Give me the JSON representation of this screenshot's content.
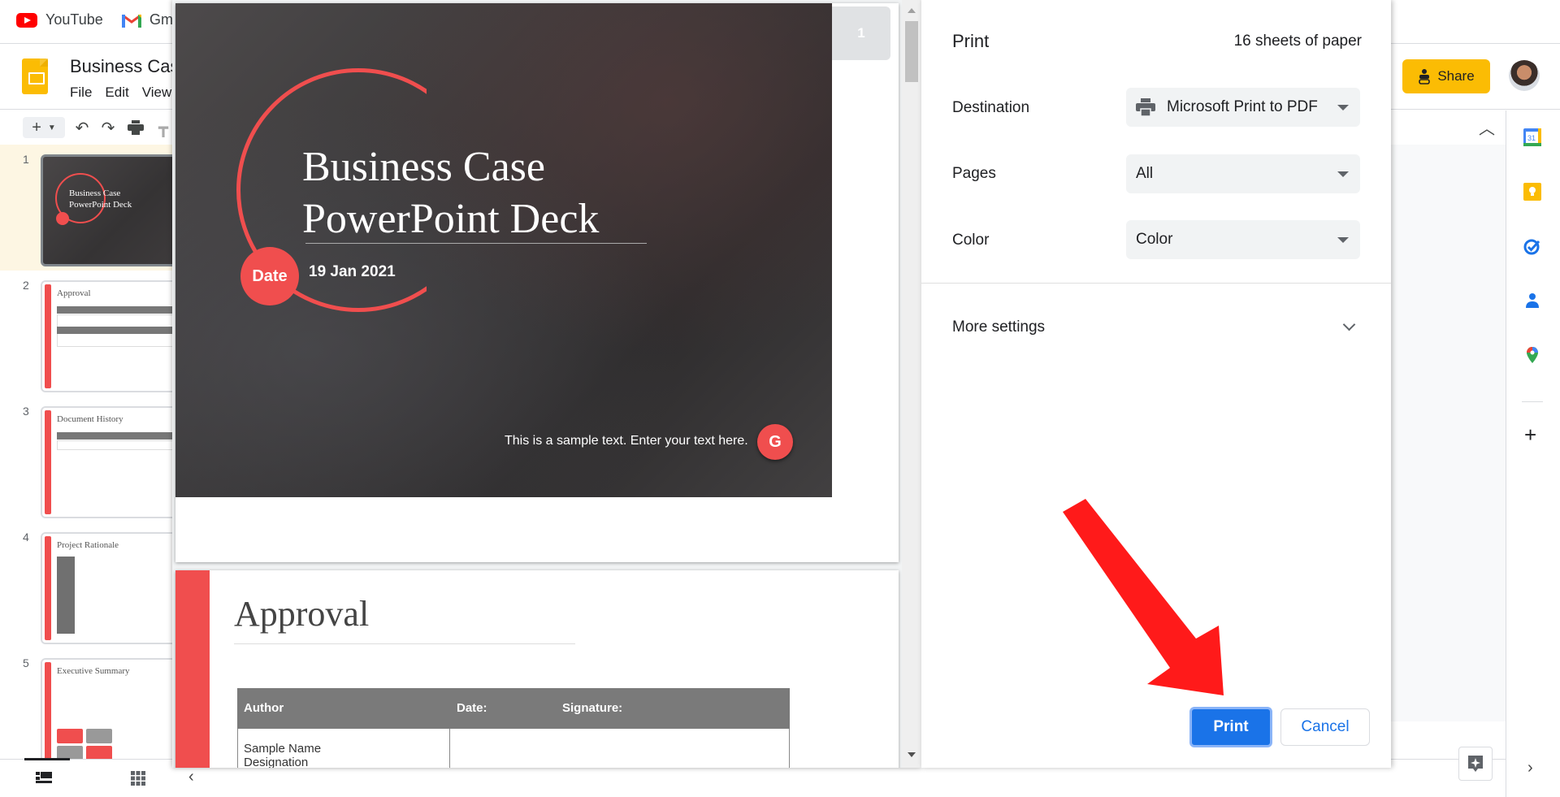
{
  "bookmarks": [
    {
      "label": "YouTube",
      "icon": "youtube-icon"
    },
    {
      "label": "Gm",
      "icon": "gmail-icon"
    }
  ],
  "app": {
    "title": "Business Cas",
    "menu": [
      "File",
      "Edit",
      "View"
    ],
    "share_label": "Share"
  },
  "filmstrip": {
    "slides": [
      {
        "num": "1",
        "title": "Business Case PowerPoint Deck",
        "selected": true
      },
      {
        "num": "2",
        "title": "Approval"
      },
      {
        "num": "3",
        "title": "Document History"
      },
      {
        "num": "4",
        "title": "Project Rationale"
      },
      {
        "num": "5",
        "title": "Executive Summary"
      }
    ]
  },
  "preview": {
    "page_badge": "1",
    "slide1": {
      "title_line1": "Business Case",
      "title_line2": "PowerPoint Deck",
      "date_label": "Date",
      "date_value": "19 Jan 2021",
      "sample_text": "This is a sample text. Enter your text here.",
      "badge": "G"
    },
    "slide2": {
      "title": "Approval",
      "table_headers": [
        "Author",
        "Date:",
        "Signature:"
      ],
      "rows": [
        [
          "Sample Name\nDesignation",
          ""
        ]
      ]
    }
  },
  "print": {
    "title": "Print",
    "sheets": "16 sheets of paper",
    "destination_label": "Destination",
    "destination_value": "Microsoft Print to PDF",
    "pages_label": "Pages",
    "pages_value": "All",
    "color_label": "Color",
    "color_value": "Color",
    "more_settings": "More settings",
    "print_button": "Print",
    "cancel_button": "Cancel"
  },
  "colors": {
    "accent_red": "#f04e4e",
    "print_blue": "#1a73e8",
    "share_yellow": "#fbbc04",
    "annotation_arrow": "#ff1a1a"
  }
}
